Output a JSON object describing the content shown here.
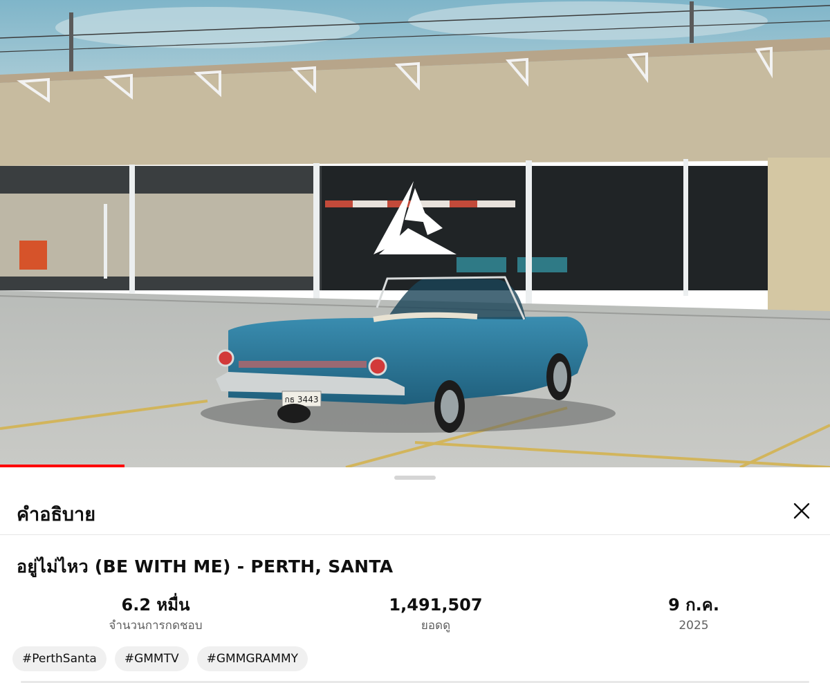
{
  "video": {
    "progress_fraction": 0.15,
    "logo_name": "channel-watermark-logo",
    "license_plate": "กธ 3443"
  },
  "panel": {
    "title": "คำอธิบาย",
    "close_icon": "close-icon"
  },
  "video_info": {
    "title": "อยู่ไม่ไหว (BE WITH ME) - PERTH, SANTA",
    "likes_value": "6.2 หมื่น",
    "likes_label": "จำนวนการกดชอบ",
    "views_value": "1,491,507",
    "views_label": "ยอดดู",
    "date_value": "9 ก.ค.",
    "date_year": "2025"
  },
  "hashtags": [
    "#PerthSanta",
    "#GMMTV",
    "#GMMGRAMMY"
  ],
  "colors": {
    "progress": "#ff0000",
    "car": "#2d7a9b",
    "sheet_bg": "#ffffff"
  }
}
